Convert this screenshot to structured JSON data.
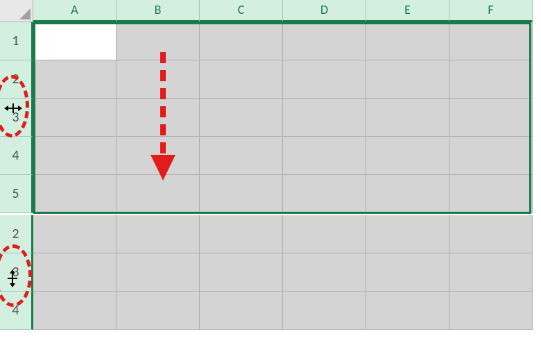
{
  "columns": [
    "A",
    "B",
    "C",
    "D",
    "E",
    "F"
  ],
  "top_rows": [
    "1",
    "2",
    "3",
    "4",
    "5"
  ],
  "bottom_rows": [
    "2",
    "3",
    "4"
  ],
  "active_cell": "A1",
  "colors": {
    "header_bg": "#d2efdf",
    "selection_border": "#1a7a4a",
    "cell_selected_bg": "#d4d4d4",
    "annotation_red": "#e21b1b"
  },
  "annotations": {
    "ellipse_top": "row-header-resize-cursor-horizontal",
    "ellipse_bottom": "row-header-resize-cursor-vertical",
    "arrow": "drag-down-indicator"
  },
  "cursors": {
    "horizontal_resize": "↔",
    "vertical_resize": "↕"
  }
}
